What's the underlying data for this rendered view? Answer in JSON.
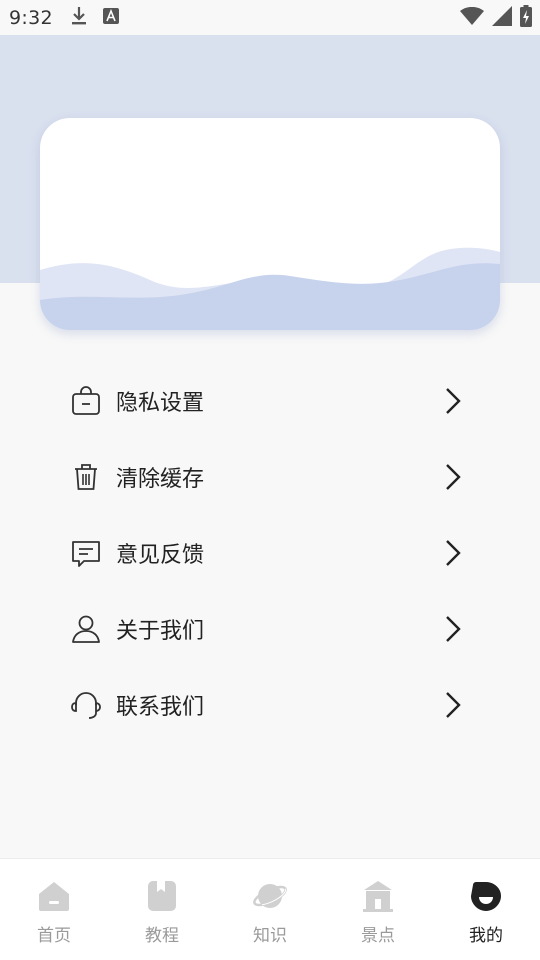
{
  "status_bar": {
    "time": "9:32",
    "icons": [
      "download-icon",
      "font-a-icon",
      "wifi-icon",
      "signal-icon",
      "battery-charging-icon"
    ]
  },
  "menu": {
    "items": [
      {
        "label": "隐私设置",
        "icon": "lock-bag-icon"
      },
      {
        "label": "清除缓存",
        "icon": "trash-icon"
      },
      {
        "label": "意见反馈",
        "icon": "feedback-message-icon"
      },
      {
        "label": "关于我们",
        "icon": "person-icon"
      },
      {
        "label": "联系我们",
        "icon": "headset-icon"
      }
    ]
  },
  "tabs": [
    {
      "label": "首页",
      "icon": "home-icon",
      "active": false
    },
    {
      "label": "教程",
      "icon": "bookmark-icon",
      "active": false
    },
    {
      "label": "知识",
      "icon": "planet-icon",
      "active": false
    },
    {
      "label": "景点",
      "icon": "building-icon",
      "active": false
    },
    {
      "label": "我的",
      "icon": "profile-face-icon",
      "active": true
    }
  ],
  "colors": {
    "header_bg": "#d9e0ee",
    "wave_dark": "#c7d2ec",
    "wave_light": "#dfe5f4",
    "tab_inactive": "#c9c9c9",
    "tab_active": "#222222"
  }
}
